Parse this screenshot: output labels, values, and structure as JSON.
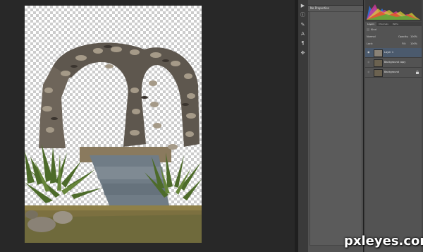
{
  "app": {
    "accent": "#4b5a6d"
  },
  "properties": {
    "title": "No Properties"
  },
  "layers_panel": {
    "tabs": [
      {
        "label": "Layers",
        "active": true
      },
      {
        "label": "Channels",
        "active": false
      },
      {
        "label": "Paths",
        "active": false
      }
    ],
    "filter_kind": "Kind",
    "blend_mode": "Normal",
    "opacity_label": "Opacity:",
    "opacity_value": "100%",
    "lock_label": "Lock:",
    "fill_label": "Fill:",
    "fill_value": "100%",
    "layers": [
      {
        "name": "Layer 1",
        "selected": true,
        "visible": true
      },
      {
        "name": "Background copy",
        "selected": false,
        "visible": false
      },
      {
        "name": "Background",
        "selected": false,
        "visible": false,
        "locked": true
      }
    ]
  },
  "icons": [
    "play-icon",
    "info-icon",
    "brush-icon",
    "type-icon",
    "paragraph-icon",
    "transform-icon",
    "eye-icon",
    "lock-icon"
  ],
  "watermark": {
    "text": "pxleyes.com"
  }
}
